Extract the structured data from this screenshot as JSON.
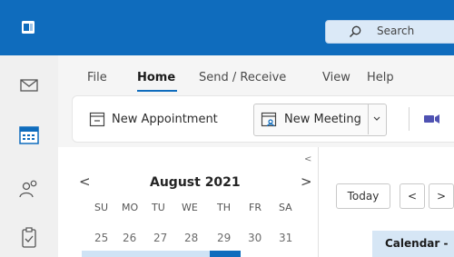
{
  "app": {
    "icon": "outlook-app-icon"
  },
  "search": {
    "placeholder": "Search",
    "icon": "search-icon"
  },
  "rail": {
    "items": [
      "mail-icon",
      "calendar-icon",
      "people-icon",
      "tasks-icon"
    ]
  },
  "menu": {
    "tabs": [
      {
        "label": "File"
      },
      {
        "label": "Home",
        "active": true
      },
      {
        "label": "Send / Receive"
      },
      {
        "label": "View"
      },
      {
        "label": "Help"
      }
    ]
  },
  "ribbon": {
    "new_appointment": "New Appointment",
    "new_meeting": "New Meeting",
    "teams_icon": "video-icon"
  },
  "calendar_nav": {
    "month": "August 2021",
    "weekdays": [
      "SU",
      "MO",
      "TU",
      "WE",
      "TH",
      "FR",
      "SA"
    ],
    "days": [
      "25",
      "26",
      "27",
      "28",
      "29",
      "30",
      "31"
    ],
    "selected_day": "29"
  },
  "right": {
    "today_label": "Today",
    "prev": "<",
    "next": ">",
    "calendar_tab": "Calendar -"
  },
  "colors": {
    "accent": "#0f6cbd",
    "rail_bg": "#f0f0f0",
    "ribbon_bg": "#f5f5f5"
  }
}
